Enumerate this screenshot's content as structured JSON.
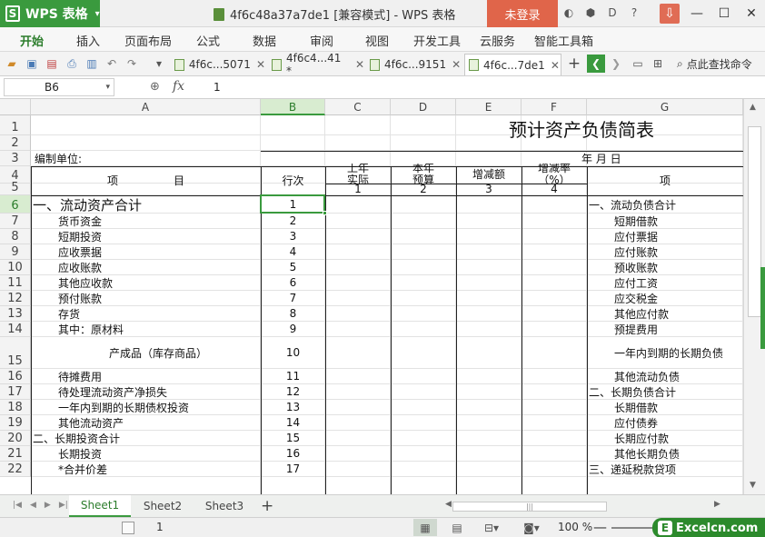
{
  "app": {
    "name": "WPS 表格",
    "doc_title": "4f6c48a37a7de1 [兼容模式] - WPS 表格",
    "login_label": "未登录"
  },
  "menu": [
    {
      "label": "开始",
      "active": true
    },
    {
      "label": "插入"
    },
    {
      "label": "页面布局"
    },
    {
      "label": "公式"
    },
    {
      "label": "数据"
    },
    {
      "label": "审阅"
    },
    {
      "label": "视图"
    },
    {
      "label": "开发工具"
    },
    {
      "label": "云服务"
    },
    {
      "label": "智能工具箱"
    }
  ],
  "doc_tabs": [
    {
      "label": "4f6c...5071",
      "active": false
    },
    {
      "label": "4f6c4...41 *",
      "active": false
    },
    {
      "label": "4f6c...9151",
      "active": false
    },
    {
      "label": "4f6c...7de1",
      "active": true
    }
  ],
  "search": {
    "label": "点此查找命令"
  },
  "formula": {
    "cell_ref": "B6",
    "fx": "fx",
    "value": "1"
  },
  "columns": [
    "A",
    "B",
    "C",
    "D",
    "E",
    "F",
    "G"
  ],
  "rows": [
    "1",
    "2",
    "3",
    "4",
    "5",
    "6",
    "7",
    "8",
    "9",
    "10",
    "11",
    "12",
    "13",
    "14",
    "15",
    "16",
    "17",
    "18",
    "19",
    "20",
    "21",
    "22"
  ],
  "report": {
    "title": "预计资产负债简表",
    "org_label": "编制单位:",
    "date_label": "年    月    日",
    "headers": {
      "item": "项                目",
      "row_no": "行次",
      "prev_actual": "上年\n实际",
      "curr_budget": "本年\n预算",
      "change_amount": "增减额",
      "change_rate": "增减率\n（%）",
      "item_right": "项"
    },
    "col_nums": [
      "1",
      "2",
      "3",
      "4"
    ]
  },
  "left_items": [
    {
      "row": 6,
      "label": "一、流动资产合计",
      "num": "1",
      "indent": 0,
      "big": true
    },
    {
      "row": 7,
      "label": "货币资金",
      "num": "2",
      "indent": 2
    },
    {
      "row": 8,
      "label": "短期投资",
      "num": "3",
      "indent": 2
    },
    {
      "row": 9,
      "label": "应收票据",
      "num": "4",
      "indent": 2
    },
    {
      "row": 10,
      "label": "应收账款",
      "num": "5",
      "indent": 2
    },
    {
      "row": 11,
      "label": "其他应收款",
      "num": "6",
      "indent": 2
    },
    {
      "row": 12,
      "label": "预付账款",
      "num": "7",
      "indent": 2
    },
    {
      "row": 13,
      "label": "存货",
      "num": "8",
      "indent": 2
    },
    {
      "row": 14,
      "label": "其中：原材料",
      "num": "9",
      "indent": 2
    },
    {
      "row": 15,
      "label": "产成品（库存商品）",
      "num": "10",
      "indent": 6
    },
    {
      "row": 16,
      "label": "待摊费用",
      "num": "11",
      "indent": 2
    },
    {
      "row": 17,
      "label": "待处理流动资产净损失",
      "num": "12",
      "indent": 2
    },
    {
      "row": 18,
      "label": "一年内到期的长期债权投资",
      "num": "13",
      "indent": 2
    },
    {
      "row": 19,
      "label": "其他流动资产",
      "num": "14",
      "indent": 2
    },
    {
      "row": 20,
      "label": "二、长期投资合计",
      "num": "15",
      "indent": 0
    },
    {
      "row": 21,
      "label": "长期投资",
      "num": "16",
      "indent": 2
    },
    {
      "row": 22,
      "label": "*合并价差",
      "num": "17",
      "indent": 2
    }
  ],
  "right_items": [
    {
      "row": 6,
      "label": "一、流动负债合计",
      "indent": 0
    },
    {
      "row": 7,
      "label": "短期借款",
      "indent": 2
    },
    {
      "row": 8,
      "label": "应付票据",
      "indent": 2
    },
    {
      "row": 9,
      "label": "应付账款",
      "indent": 2
    },
    {
      "row": 10,
      "label": "预收账款",
      "indent": 2
    },
    {
      "row": 11,
      "label": "应付工资",
      "indent": 2
    },
    {
      "row": 12,
      "label": "应交税金",
      "indent": 2
    },
    {
      "row": 13,
      "label": "其他应付款",
      "indent": 2
    },
    {
      "row": 14,
      "label": "预提费用",
      "indent": 2
    },
    {
      "row": 15,
      "label": "一年内到期的长期负债",
      "indent": 2
    },
    {
      "row": 16,
      "label": "其他流动负债",
      "indent": 2
    },
    {
      "row": 17,
      "label": "二、长期负债合计",
      "indent": 0
    },
    {
      "row": 18,
      "label": "长期借款",
      "indent": 2
    },
    {
      "row": 19,
      "label": "应付债券",
      "indent": 2
    },
    {
      "row": 20,
      "label": "长期应付款",
      "indent": 2
    },
    {
      "row": 21,
      "label": "其他长期负债",
      "indent": 2
    },
    {
      "row": 22,
      "label": "三、递延税款贷项",
      "indent": 0
    }
  ],
  "sheets": [
    {
      "label": "Sheet1",
      "active": true
    },
    {
      "label": "Sheet2",
      "active": false
    },
    {
      "label": "Sheet3",
      "active": false
    }
  ],
  "status": {
    "page_num": "1",
    "zoom": "100 %"
  },
  "brand": {
    "text": "Excelcn.com",
    "badge": "E"
  }
}
